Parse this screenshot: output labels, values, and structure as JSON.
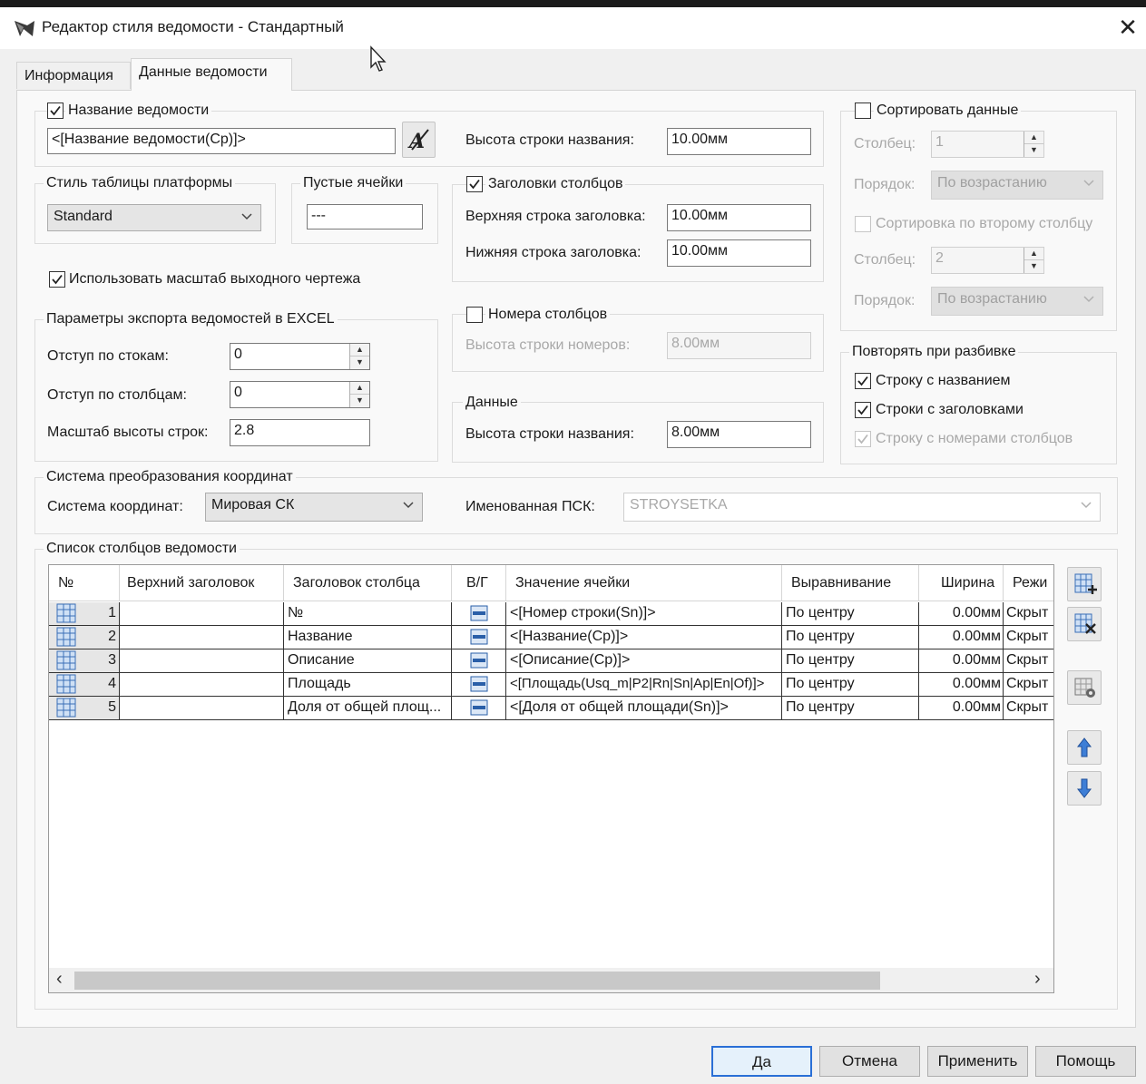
{
  "window": {
    "title": "Редактор стиля ведомости - Стандартный",
    "close_glyph": "✕"
  },
  "tabs": [
    {
      "label": "Информация",
      "active": false
    },
    {
      "label": "Данные ведомости",
      "active": true
    }
  ],
  "title_group": {
    "checkbox_label": "Название ведомости",
    "checked": true,
    "name_value": "<[Название ведомости(Cp)]>",
    "height_label": "Высота строки названия:",
    "height_value": "10.00мм"
  },
  "platform_style": {
    "label": "Стиль таблицы платформы",
    "value": "Standard"
  },
  "empty_cells": {
    "label": "Пустые ячейки",
    "value": "---"
  },
  "column_headers": {
    "checkbox_label": "Заголовки столбцов",
    "checked": true,
    "top_label": "Верхняя строка заголовка:",
    "top_value": "10.00мм",
    "bottom_label": "Нижняя строка заголовка:",
    "bottom_value": "10.00мм"
  },
  "use_scale": {
    "label": "Использовать масштаб выходного чертежа",
    "checked": true
  },
  "excel": {
    "label": "Параметры экспорта ведомостей в EXCEL",
    "row_offset_label": "Отступ по стокам:",
    "row_offset_value": "0",
    "col_offset_label": "Отступ по столбцам:",
    "col_offset_value": "0",
    "row_scale_label": "Масштаб высоты строк:",
    "row_scale_value": "2.8"
  },
  "column_numbers": {
    "checkbox_label": "Номера столбцов",
    "checked": false,
    "height_label": "Высота строки номеров:",
    "height_value": "8.00мм"
  },
  "data_group": {
    "label": "Данные",
    "height_label": "Высота строки названия:",
    "height_value": "8.00мм"
  },
  "sort": {
    "checkbox_label": "Сортировать данные",
    "checked": false,
    "col1_label": "Столбец:",
    "col1_value": "1",
    "order1_label": "Порядок:",
    "order1_value": "По возрастанию",
    "second_label": "Сортировка по второму столбцу",
    "col2_label": "Столбец:",
    "col2_value": "2",
    "order2_label": "Порядок:",
    "order2_value": "По возрастанию"
  },
  "repeat": {
    "label": "Повторять при разбивке",
    "title_row_label": "Строку с названием",
    "title_row_checked": true,
    "header_rows_label": "Строки с заголовками",
    "header_rows_checked": true,
    "num_row_label": "Строку с номерами столбцов",
    "num_row_checked": true
  },
  "coords": {
    "label": "Система преобразования координат",
    "system_label": "Система координат:",
    "system_value": "Мировая СК",
    "ucs_label": "Именованная ПСК:",
    "ucs_value": "STROYSETKA"
  },
  "columns_list": {
    "label": "Список столбцов ведомости",
    "headers": [
      "№",
      "Верхний заголовок",
      "Заголовок столбца",
      "В/Г",
      "Значение ячейки",
      "Выравнивание",
      "Ширина",
      "Режи"
    ],
    "rows": [
      {
        "num": "1",
        "top": "",
        "header": "№",
        "value": "<[Номер строки(Sn)]>",
        "align": "По центру",
        "width": "0.00мм",
        "mode": "Скрыт"
      },
      {
        "num": "2",
        "top": "",
        "header": "Название",
        "value": "<[Название(Cp)]>",
        "align": "По центру",
        "width": "0.00мм",
        "mode": "Скрыт"
      },
      {
        "num": "3",
        "top": "",
        "header": "Описание",
        "value": "<[Описание(Cp)]>",
        "align": "По центру",
        "width": "0.00мм",
        "mode": "Скрыт"
      },
      {
        "num": "4",
        "top": "",
        "header": "Площадь",
        "value": "<[Площадь(Usq_m|P2|Rn|Sn|Ap|En|Of)]>",
        "align": "По центру",
        "width": "0.00мм",
        "mode": "Скрыт"
      },
      {
        "num": "5",
        "top": "",
        "header": "Доля от общей площ...",
        "value": "<[Доля от общей площади(Sn)]>",
        "align": "По центру",
        "width": "0.00мм",
        "mode": "Скрыт"
      }
    ],
    "scroll_left": "‹",
    "scroll_right": "›"
  },
  "footer": {
    "ok": "Да",
    "cancel": "Отмена",
    "apply": "Применить",
    "help": "Помощь"
  },
  "colors": {
    "accent": "#2a6fd6",
    "dialog_bg": "#f0f0f0",
    "panel_bg": "#f9f9f9"
  }
}
